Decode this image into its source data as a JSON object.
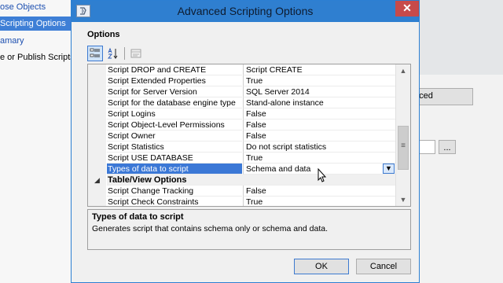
{
  "background": {
    "nav_items": [
      {
        "label": "ose Objects",
        "selected": false
      },
      {
        "label": "Scripting Options",
        "selected": true
      },
      {
        "label": "amary",
        "selected": false
      },
      {
        "label": "e or Publish Scripts",
        "selected": false
      }
    ],
    "advanced_button_label": "nced",
    "browse_button_label": "..."
  },
  "dialog": {
    "title": "Advanced Scripting Options",
    "close_glyph": "✕",
    "options_label": "Options",
    "toolbar": {
      "categorized_icon": "categorized-icon",
      "alphabetical_icon": "alphabetical-icon",
      "property_pages_icon": "property-pages-icon"
    },
    "properties": [
      {
        "name": "Script DROP and CREATE",
        "value": "Script CREATE"
      },
      {
        "name": "Script Extended Properties",
        "value": "True"
      },
      {
        "name": "Script for Server Version",
        "value": "SQL Server 2014"
      },
      {
        "name": "Script for the database engine type",
        "value": "Stand-alone instance"
      },
      {
        "name": "Script Logins",
        "value": "False"
      },
      {
        "name": "Script Object-Level Permissions",
        "value": "False"
      },
      {
        "name": "Script Owner",
        "value": "False"
      },
      {
        "name": "Script Statistics",
        "value": "Do not script statistics"
      },
      {
        "name": "Script USE DATABASE",
        "value": "True"
      },
      {
        "name": "Types of data to script",
        "value": "Schema and data",
        "selected": true
      }
    ],
    "category": {
      "name": "Table/View Options",
      "glyph": "◢"
    },
    "category_properties": [
      {
        "name": "Script Change Tracking",
        "value": "False"
      },
      {
        "name": "Script Check Constraints",
        "value": "True"
      }
    ],
    "description": {
      "title": "Types of data to script",
      "text": "Generates script that contains schema only or schema and data."
    },
    "ok_label": "OK",
    "cancel_label": "Cancel"
  },
  "colors": {
    "titlebar": "#2f7fd0",
    "selection": "#3b78d6",
    "nav_selected": "#3e7fd6"
  }
}
